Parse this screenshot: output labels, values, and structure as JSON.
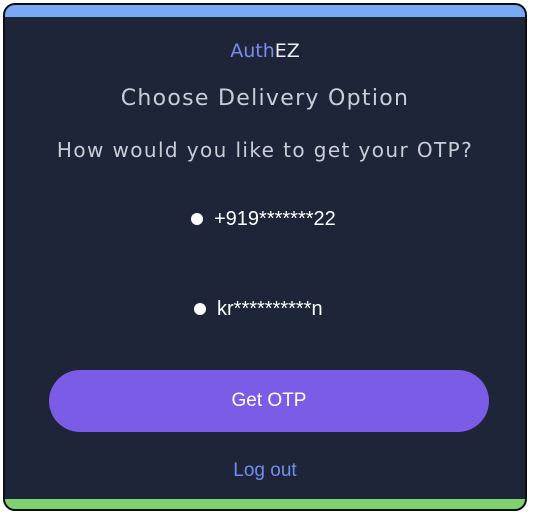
{
  "app": {
    "brand_part1": "Auth",
    "brand_part2": "EZ"
  },
  "page": {
    "heading": "Choose Delivery Option",
    "question": "How would you like to get your OTP?"
  },
  "options": [
    {
      "label": "+919*******22"
    },
    {
      "label": "kr**********n"
    }
  ],
  "actions": {
    "get_otp_label": "Get OTP",
    "logout_label": "Log out"
  },
  "colors": {
    "card_background": "#1e2539",
    "top_accent": "#78a9f5",
    "bottom_accent": "#7fd26e",
    "brand_accent": "#7b8cf0",
    "primary_button": "#7b5ce6",
    "link": "#6f8ff0"
  }
}
